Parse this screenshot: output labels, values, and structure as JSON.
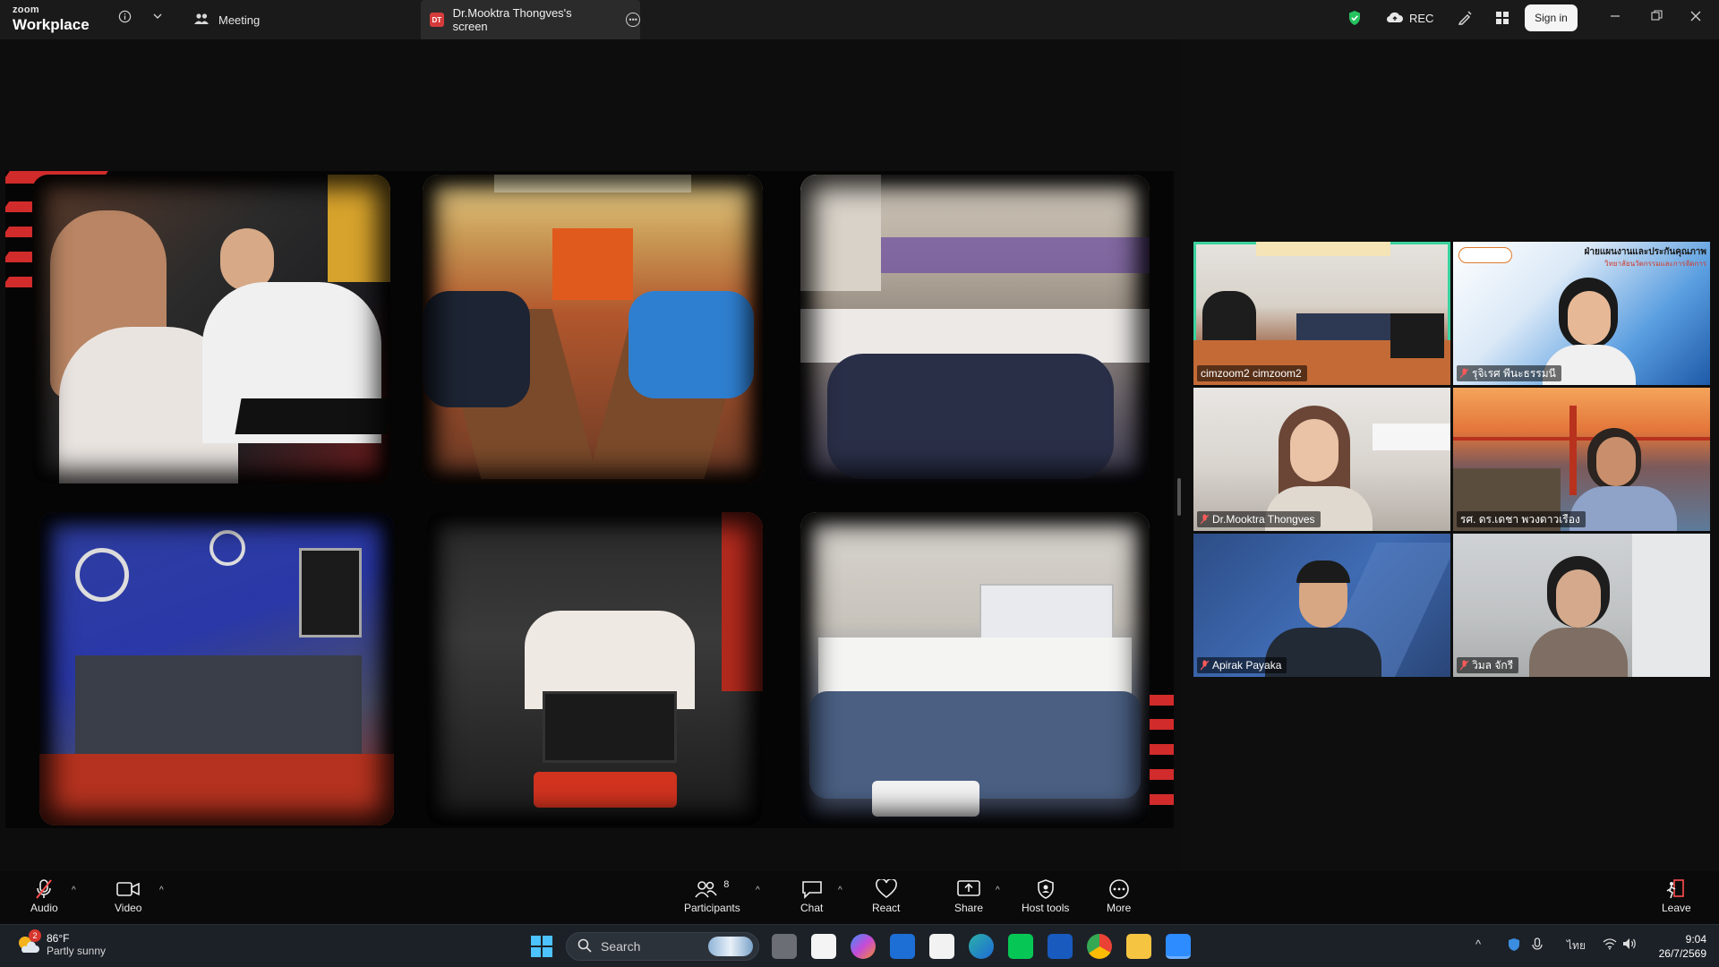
{
  "app": {
    "brand_top": "zoom",
    "brand_bottom": "Workplace",
    "meeting_tab": "Meeting",
    "screen_tab_badge": "DT",
    "screen_tab_label": "Dr.Mooktra Thongves's screen",
    "rec_label": "REC",
    "signin_label": "Sign in"
  },
  "gallery": {
    "tiles": [
      {
        "name": "cimzoom2 cimzoom2",
        "active": true,
        "muted": false
      },
      {
        "name": "รุจิเรศ พีนะธรรมนี",
        "active": false,
        "muted": true
      },
      {
        "name": "Dr.Mooktra Thongves",
        "active": false,
        "muted": true
      },
      {
        "name": "รศ. ดร.เดชา พวงดาวเรือง",
        "active": false,
        "muted": false
      },
      {
        "name": "Apirak Payaka",
        "active": false,
        "muted": true
      },
      {
        "name": "วิมล จักรี",
        "active": false,
        "muted": true
      }
    ],
    "tile2_banner": "ฝ่ายแผนงานและประกันคุณภาพ",
    "tile2_sub": "วิทยาลัยนวัตกรรมและการจัดการ"
  },
  "toolbar": {
    "audio": "Audio",
    "video": "Video",
    "participants": "Participants",
    "participants_count": "8",
    "chat": "Chat",
    "react": "React",
    "share": "Share",
    "host_tools": "Host tools",
    "more": "More",
    "leave": "Leave"
  },
  "taskbar": {
    "weather_badge": "2",
    "temperature": "86°F",
    "condition": "Partly sunny",
    "search_placeholder": "Search",
    "time": "9:04",
    "date": "26/7/2569",
    "lang": "ไทย"
  },
  "colors": {
    "active_speaker": "#3ad29f",
    "accent_red": "#d12b2b",
    "zoom_blue": "#2d8cff"
  }
}
